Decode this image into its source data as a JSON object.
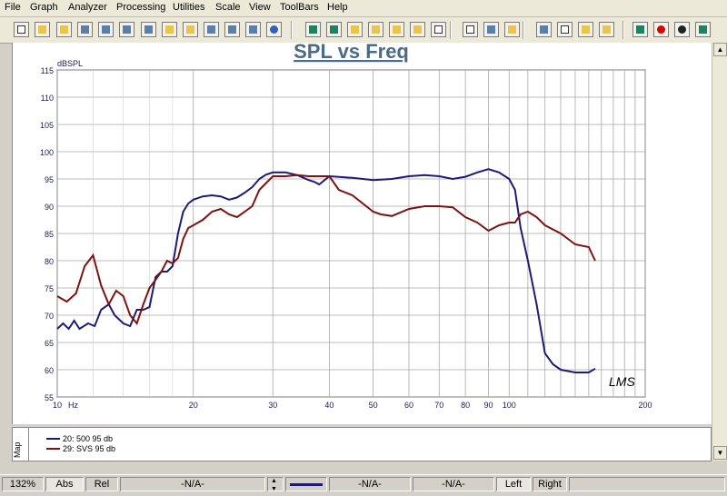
{
  "menu": [
    "File",
    "Graph",
    "Analyzer",
    "Processing",
    "Utilities",
    "Scale",
    "View",
    "ToolBars",
    "Help"
  ],
  "toolbar_icons": [
    "new-icon",
    "open-icon",
    "open-folder-icon",
    "save-icon",
    "save-as-icon",
    "import-icon",
    "export-icon",
    "settings-icon",
    "folder-icon",
    "disk-icon",
    "print-icon",
    "copy-icon",
    "target-icon",
    "zoom-in-icon",
    "zoom-out-icon",
    "overlay-1-icon",
    "overlay-2-icon",
    "overlay-3-icon",
    "overlay-4-icon",
    "grid-icon",
    "window-icon",
    "spectrum-icon",
    "hand-icon",
    "split-icon",
    "table-icon",
    "marker-icon",
    "marker-2-icon",
    "filter-icon",
    "record-icon",
    "stop-icon",
    "calc-icon"
  ],
  "side_tab_label": "Map",
  "status": {
    "zoom": "132%",
    "abs": "Abs",
    "rel": "Rel",
    "field1": "-N/A-",
    "field2": "-N/A-",
    "field3": "-N/A-",
    "left": "Left",
    "right": "Right"
  },
  "colors": {
    "series1": "#1c1c74",
    "series2": "#7a1414",
    "title": "#4a6a86",
    "grid": "#a8a8a8"
  },
  "chart_data": {
    "type": "line",
    "title": "SPL vs Freq",
    "ylabel": "dBSPL",
    "xlabel": "",
    "x_unit_label": "Hz",
    "x_scale": "log",
    "xlim": [
      10,
      200
    ],
    "ylim": [
      55,
      115
    ],
    "y_ticks": [
      55,
      60,
      65,
      70,
      75,
      80,
      85,
      90,
      95,
      100,
      105,
      110,
      115
    ],
    "x_ticks": [
      10,
      20,
      30,
      40,
      50,
      60,
      70,
      80,
      90,
      100,
      200
    ],
    "grid": true,
    "legend_position": "bottom-left",
    "watermark": "LMS",
    "series": [
      {
        "name": "20: 500 95 db",
        "color": "#1c1c74",
        "points": [
          [
            10,
            67.5
          ],
          [
            10.3,
            68.5
          ],
          [
            10.6,
            67.5
          ],
          [
            10.9,
            69
          ],
          [
            11.2,
            67.5
          ],
          [
            11.7,
            68.5
          ],
          [
            12.1,
            68
          ],
          [
            12.5,
            71
          ],
          [
            13,
            72
          ],
          [
            13.4,
            70
          ],
          [
            14,
            68.5
          ],
          [
            14.5,
            68
          ],
          [
            15,
            71
          ],
          [
            15.5,
            71
          ],
          [
            16,
            71.5
          ],
          [
            16.5,
            77
          ],
          [
            17,
            78
          ],
          [
            17.5,
            78
          ],
          [
            18,
            79
          ],
          [
            18.5,
            85
          ],
          [
            19,
            89
          ],
          [
            19.5,
            90.5
          ],
          [
            20,
            91.2
          ],
          [
            21,
            91.8
          ],
          [
            22,
            92
          ],
          [
            23,
            91.8
          ],
          [
            24,
            91.2
          ],
          [
            25,
            91.6
          ],
          [
            26,
            92.5
          ],
          [
            27,
            93.5
          ],
          [
            28,
            95
          ],
          [
            29,
            95.8
          ],
          [
            30,
            96.2
          ],
          [
            32,
            96.2
          ],
          [
            34,
            95.7
          ],
          [
            36,
            94.8
          ],
          [
            37,
            94.5
          ],
          [
            38,
            94
          ],
          [
            40,
            95.5
          ],
          [
            45,
            95.2
          ],
          [
            50,
            94.8
          ],
          [
            55,
            95
          ],
          [
            60,
            95.5
          ],
          [
            65,
            95.7
          ],
          [
            70,
            95.5
          ],
          [
            75,
            95
          ],
          [
            80,
            95.4
          ],
          [
            85,
            96.2
          ],
          [
            90,
            96.8
          ],
          [
            95,
            96.2
          ],
          [
            100,
            95
          ],
          [
            103,
            93
          ],
          [
            106,
            86
          ],
          [
            110,
            80
          ],
          [
            115,
            72
          ],
          [
            120,
            63
          ],
          [
            125,
            61
          ],
          [
            130,
            60
          ],
          [
            140,
            59.5
          ],
          [
            150,
            59.5
          ],
          [
            155,
            60.2
          ]
        ]
      },
      {
        "name": "29: SVS 95 db",
        "color": "#7a1414",
        "points": [
          [
            10,
            73.5
          ],
          [
            10.5,
            72.5
          ],
          [
            11,
            74
          ],
          [
            11.5,
            79
          ],
          [
            12,
            81
          ],
          [
            12.5,
            75.5
          ],
          [
            13,
            72
          ],
          [
            13.5,
            74.5
          ],
          [
            14,
            73.5
          ],
          [
            14.5,
            70
          ],
          [
            15,
            68.5
          ],
          [
            15.5,
            72
          ],
          [
            16,
            75
          ],
          [
            16.5,
            76.5
          ],
          [
            17,
            78
          ],
          [
            17.5,
            80
          ],
          [
            18,
            79.5
          ],
          [
            18.5,
            80.5
          ],
          [
            19,
            84
          ],
          [
            19.5,
            86
          ],
          [
            20,
            86.5
          ],
          [
            21,
            87.5
          ],
          [
            22,
            89
          ],
          [
            23,
            89.5
          ],
          [
            24,
            88.5
          ],
          [
            25,
            88
          ],
          [
            26,
            89
          ],
          [
            27,
            90
          ],
          [
            28,
            93
          ],
          [
            30,
            95.5
          ],
          [
            32,
            95.5
          ],
          [
            34,
            95.7
          ],
          [
            36,
            95.5
          ],
          [
            38,
            95.5
          ],
          [
            40,
            95.5
          ],
          [
            42,
            93
          ],
          [
            45,
            92
          ],
          [
            50,
            89
          ],
          [
            52,
            88.5
          ],
          [
            55,
            88.2
          ],
          [
            60,
            89.5
          ],
          [
            65,
            90
          ],
          [
            70,
            90
          ],
          [
            75,
            89.8
          ],
          [
            80,
            88
          ],
          [
            85,
            87
          ],
          [
            90,
            85.5
          ],
          [
            95,
            86.5
          ],
          [
            100,
            87
          ],
          [
            103,
            87
          ],
          [
            106,
            88.5
          ],
          [
            110,
            89
          ],
          [
            115,
            88
          ],
          [
            120,
            86.5
          ],
          [
            130,
            85
          ],
          [
            140,
            83
          ],
          [
            150,
            82.5
          ],
          [
            155,
            80
          ]
        ]
      }
    ]
  }
}
